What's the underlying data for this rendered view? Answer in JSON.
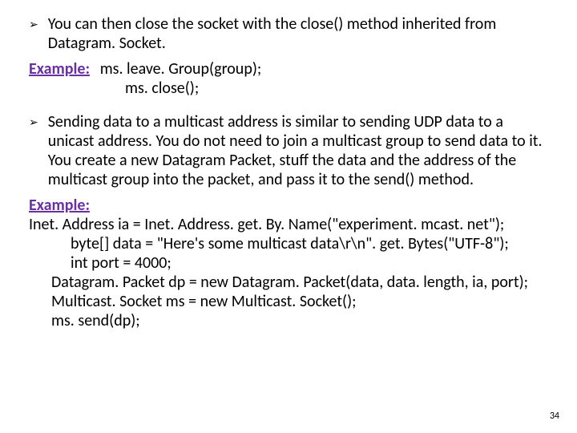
{
  "bullet1": {
    "marker": "➢",
    "text": "You can then close the socket with the close() method inherited from Datagram. Socket."
  },
  "example1": {
    "label": "Example:",
    "line1": "ms. leave. Group(group);",
    "line2": "ms. close();"
  },
  "bullet2": {
    "marker": "➢",
    "text": "Sending data to a multicast address is similar to sending UDP data to a unicast address. You do not need to join a multicast group to send data to it. You create a new Datagram Packet, stuff the data and the address of the multicast group into the packet, and pass it to the send() method."
  },
  "example2": {
    "label": "Example:",
    "line1": "Inet. Address ia =  Inet. Address. get. By. Name(\"experiment. mcast. net\");",
    "line2": "byte[] data = \"Here's some multicast data\\r\\n\". get. Bytes(\"UTF-8\");",
    "line3": "int port = 4000;",
    "line4": "Datagram. Packet dp = new Datagram. Packet(data, data. length, ia, port);",
    "line5": "Multicast. Socket ms = new Multicast. Socket();",
    "line6": "ms. send(dp);"
  },
  "pageNumber": "34"
}
